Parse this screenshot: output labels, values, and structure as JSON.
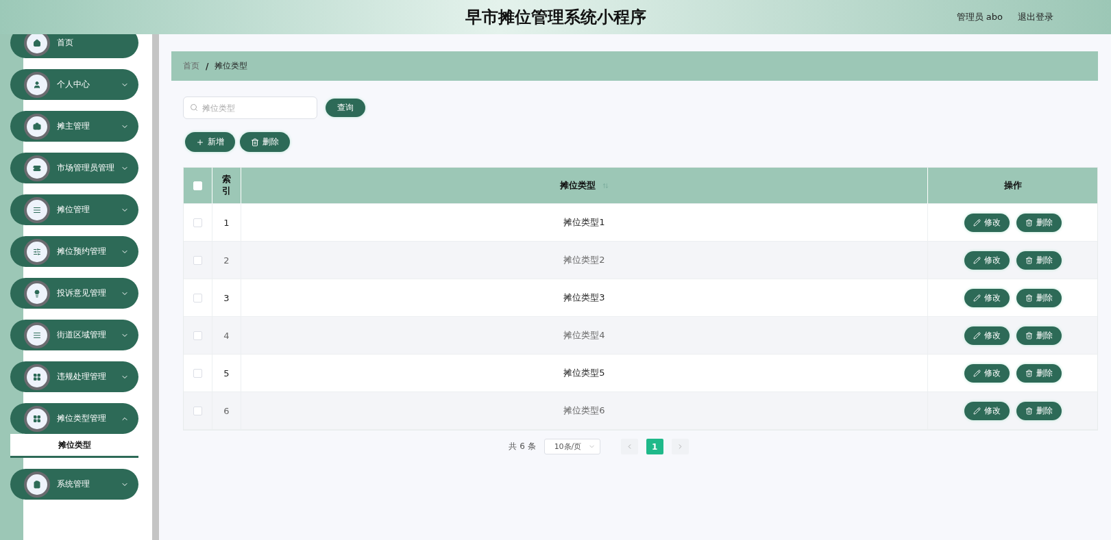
{
  "header": {
    "title": "早市摊位管理系统小程序",
    "user": "管理员 abo",
    "logout": "退出登录"
  },
  "sidebar": {
    "items": [
      {
        "label": "首页",
        "kind": "link"
      },
      {
        "label": "个人中心",
        "kind": "submenu",
        "expanded": false
      },
      {
        "label": "摊主管理",
        "kind": "submenu",
        "expanded": false
      },
      {
        "label": "市场管理员管理",
        "kind": "submenu",
        "expanded": false
      },
      {
        "label": "摊位管理",
        "kind": "submenu",
        "expanded": false
      },
      {
        "label": "摊位预约管理",
        "kind": "submenu",
        "expanded": false
      },
      {
        "label": "投诉意见管理",
        "kind": "submenu",
        "expanded": false
      },
      {
        "label": "街道区域管理",
        "kind": "submenu",
        "expanded": false
      },
      {
        "label": "违规处理管理",
        "kind": "submenu",
        "expanded": false
      },
      {
        "label": "摊位类型管理",
        "kind": "submenu",
        "expanded": true,
        "children": [
          {
            "label": "摊位类型",
            "selected": true
          }
        ]
      },
      {
        "label": "系统管理",
        "kind": "submenu",
        "expanded": false
      }
    ]
  },
  "breadcrumb": {
    "separator": "/",
    "items": [
      "首页",
      "摊位类型"
    ]
  },
  "search": {
    "placeholder": "摊位类型",
    "button": "查询"
  },
  "actions": [
    {
      "label": "新增",
      "kind": "add"
    },
    {
      "label": "删除",
      "kind": "delete"
    }
  ],
  "table": {
    "select_all_checked": false,
    "columns": [
      "索引",
      "摊位类型",
      "操作"
    ],
    "rows": [
      {
        "checked": false,
        "index": "1",
        "type": "摊位类型1",
        "edit": "修改",
        "delete": "删除"
      },
      {
        "checked": false,
        "index": "2",
        "type": "摊位类型2",
        "edit": "修改",
        "delete": "删除"
      },
      {
        "checked": false,
        "index": "3",
        "type": "摊位类型3",
        "edit": "修改",
        "delete": "删除"
      },
      {
        "checked": false,
        "index": "4",
        "type": "摊位类型4",
        "edit": "修改",
        "delete": "删除"
      },
      {
        "checked": false,
        "index": "5",
        "type": "摊位类型5",
        "edit": "修改",
        "delete": "删除"
      },
      {
        "checked": false,
        "index": "6",
        "type": "摊位类型6",
        "edit": "修改",
        "delete": "删除"
      }
    ]
  },
  "pagination": {
    "total": "共 6 条",
    "page_size": "10条/页",
    "pages": [
      {
        "label": "1",
        "selected": true
      }
    ]
  }
}
